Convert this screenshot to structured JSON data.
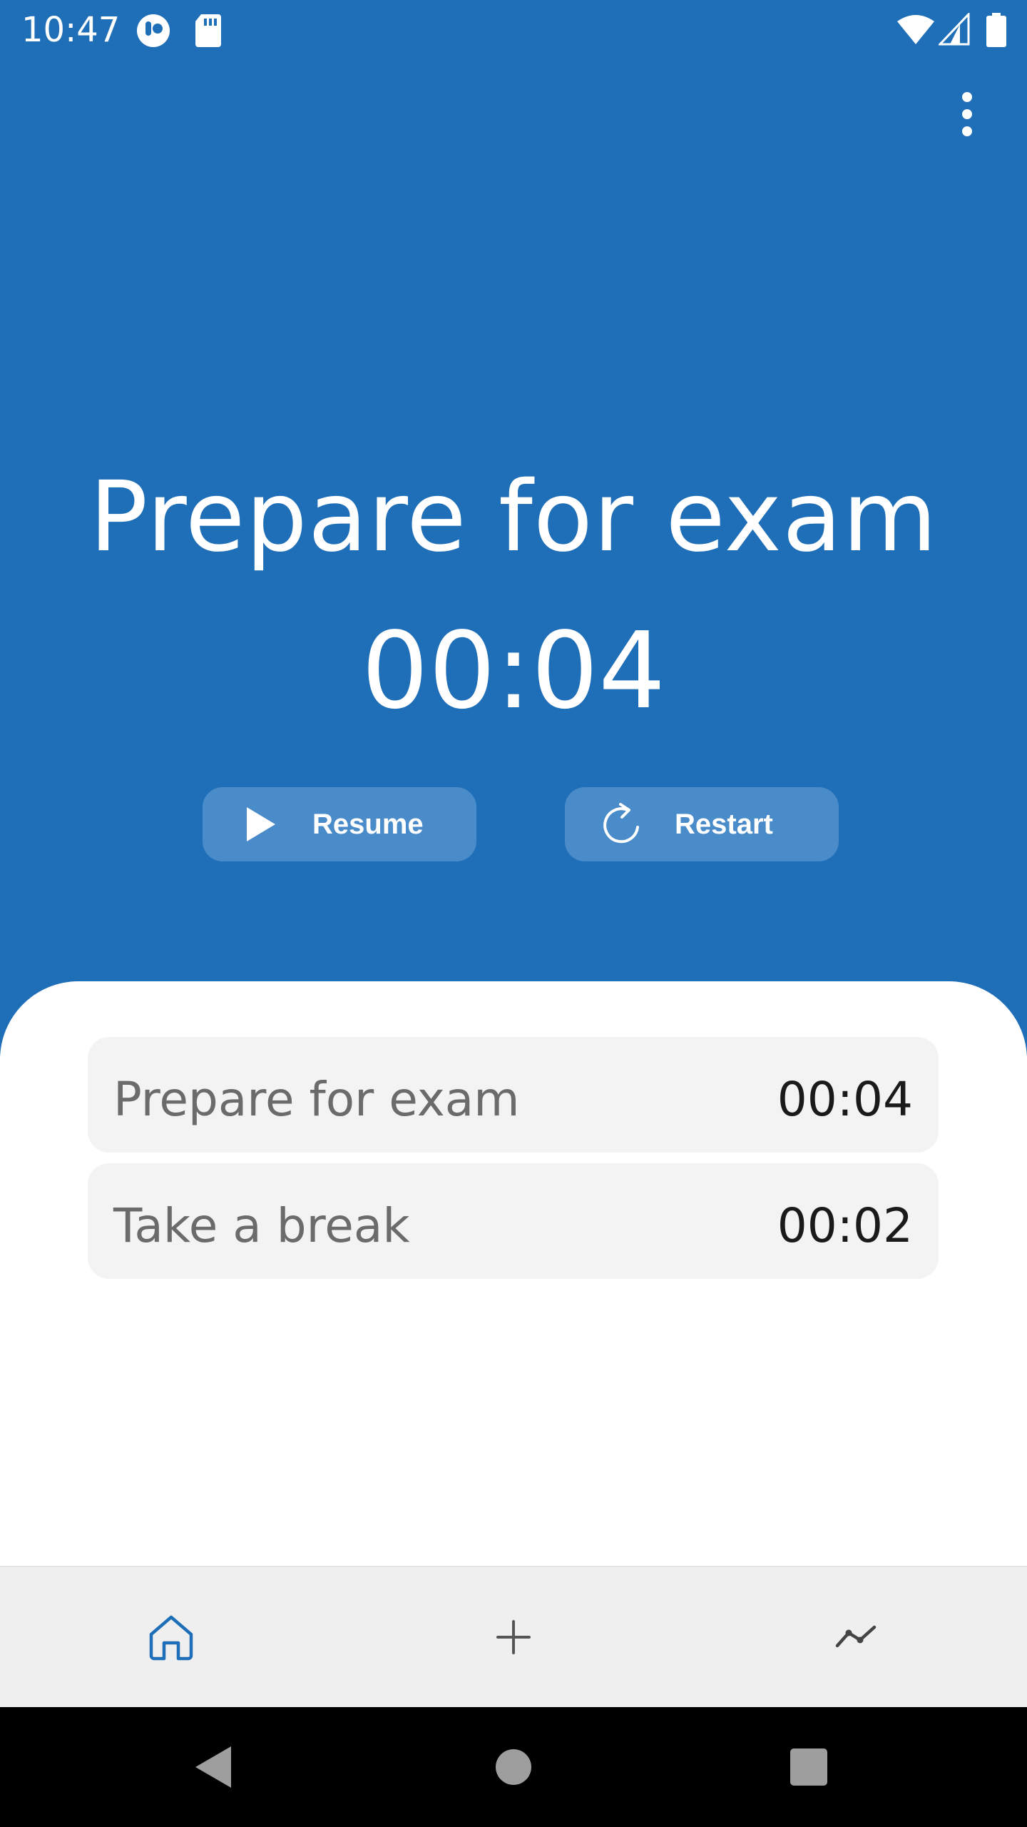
{
  "status_bar": {
    "time": "10:47",
    "left_icons": [
      "app-notification-icon",
      "sd-card-icon"
    ],
    "right_icons": [
      "wifi-icon",
      "cell-signal-icon",
      "battery-icon"
    ]
  },
  "toolbar": {
    "overflow_icon": "more-vert-icon"
  },
  "current_task": {
    "title": "Prepare for exam",
    "timer": "00:04"
  },
  "controls": {
    "resume_label": "Resume",
    "resume_icon": "play-icon",
    "restart_label": "Restart",
    "restart_icon": "restart-icon"
  },
  "tasks": [
    {
      "name": "Prepare for exam",
      "duration": "00:04"
    },
    {
      "name": "Take a break",
      "duration": "00:02"
    }
  ],
  "bottom_nav": {
    "items": [
      {
        "icon": "home-icon",
        "selected": true
      },
      {
        "icon": "add-icon",
        "selected": false
      },
      {
        "icon": "stats-icon",
        "selected": false
      }
    ]
  },
  "system_nav": [
    "back-icon",
    "home-circle-icon",
    "recents-icon"
  ],
  "colors": {
    "primary": "#1f6fb8",
    "button": "#4a8bc9",
    "row_background": "#f3f3f3",
    "nav_background": "#efefef"
  }
}
